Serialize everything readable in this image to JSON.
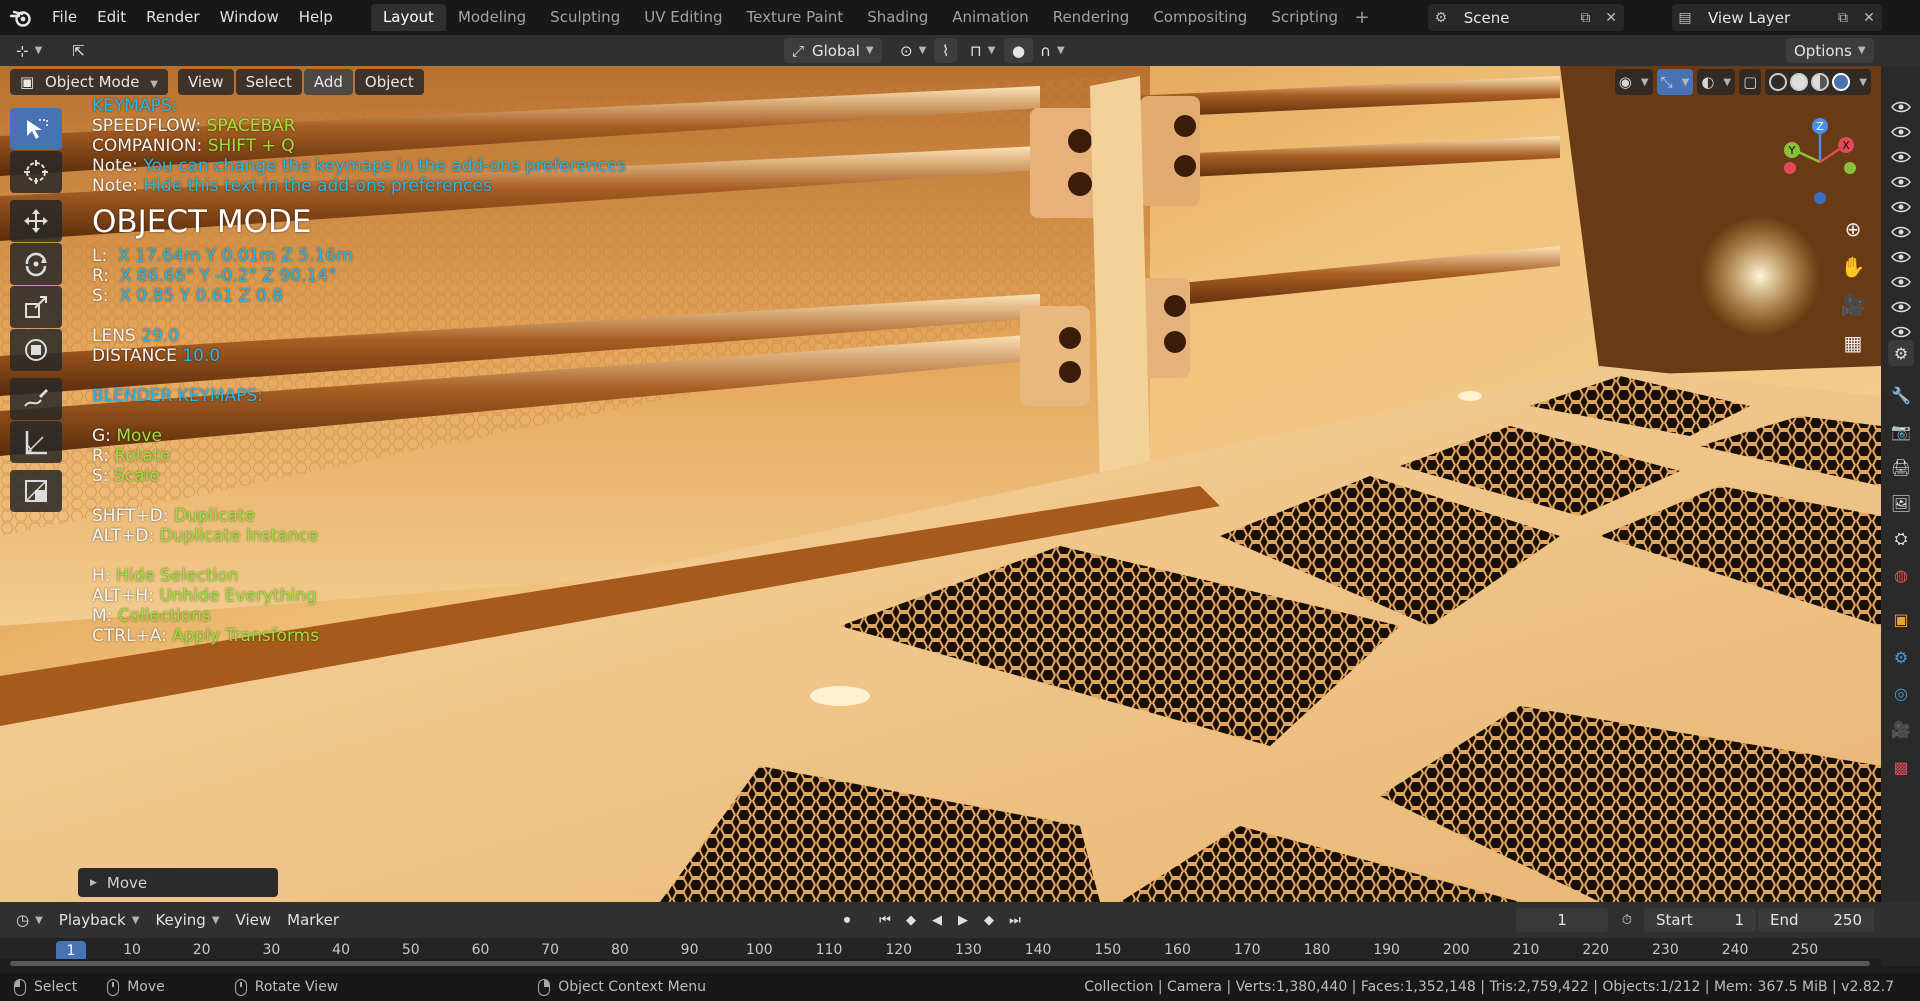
{
  "menubar": {
    "items": [
      "File",
      "Edit",
      "Render",
      "Window",
      "Help"
    ],
    "workspaces": [
      "Layout",
      "Modeling",
      "Sculpting",
      "UV Editing",
      "Texture Paint",
      "Shading",
      "Animation",
      "Rendering",
      "Compositing",
      "Scripting"
    ],
    "active_workspace": "Layout",
    "add_tab": "+",
    "scene": "Scene",
    "view_layer": "View Layer"
  },
  "header": {
    "orientation": "Global",
    "options": "Options"
  },
  "viewport_header": {
    "mode": "Object Mode",
    "menus": [
      "View",
      "Select",
      "Add",
      "Object"
    ]
  },
  "overlay": {
    "keymaps_title": "KEYMAPS:",
    "speedflow_label": "SPEEDFLOW:",
    "speedflow_key": "SPACEBAR",
    "companion_label": "COMPANION:",
    "companion_key": "SHIFT + Q",
    "note_label": "Note:",
    "note1": "You can change the keymaps in the add-ons preferences",
    "note2": "Hide this text in the add-ons preferences",
    "mode_title": "OBJECT MODE",
    "location_label": "L:",
    "location_value": "X 17.64m Y 0.01m Z 5.16m",
    "rotation_label": "R:",
    "rotation_value": "X 86.66° Y -0.2° Z 90.14°",
    "scale_label": "S:",
    "scale_value": "X 0.85 Y 0.61 Z 0.8",
    "lens_label": "LENS",
    "lens_value": "29.0",
    "distance_label": "DISTANCE",
    "distance_value": "10.0",
    "blender_keymaps_title": "BLENDER KEYMAPS:",
    "shortcuts": [
      {
        "key": "G:",
        "action": "Move"
      },
      {
        "key": "R:",
        "action": "Rotate"
      },
      {
        "key": "S:",
        "action": "Scale"
      },
      {
        "key": "SHFT+D:",
        "action": "Duplicate"
      },
      {
        "key": "ALT+D:",
        "action": "Duplicate Instance"
      },
      {
        "key": "H:",
        "action": "Hide Selection"
      },
      {
        "key": "ALT+H:",
        "action": "Unhide Everything"
      },
      {
        "key": "M:",
        "action": "Collections"
      },
      {
        "key": "CTRL+A:",
        "action": "Apply Transforms"
      }
    ]
  },
  "gizmo": {
    "x": "X",
    "y": "Y",
    "z": "Z"
  },
  "operator_panel": {
    "label": "Move"
  },
  "timeline": {
    "menus": [
      "Playback",
      "Keying",
      "View",
      "Marker"
    ],
    "current_frame": "1",
    "start_label": "Start",
    "start_value": "1",
    "end_label": "End",
    "end_value": "250",
    "ruler_current": "1",
    "ruler_ticks": [
      "10",
      "20",
      "30",
      "40",
      "50",
      "60",
      "70",
      "80",
      "90",
      "100",
      "110",
      "120",
      "130",
      "140",
      "150",
      "160",
      "170",
      "180",
      "190",
      "200",
      "210",
      "220",
      "230",
      "240",
      "250"
    ]
  },
  "statusbar": {
    "select": "Select",
    "move": "Move",
    "rotate_view": "Rotate View",
    "context_menu": "Object Context Menu",
    "stats": "Collection | Camera | Verts:1,380,440 | Faces:1,352,148 | Tris:2,759,422 | Objects:1/212 | Mem: 367.5 MiB | v2.82.7"
  },
  "colors": {
    "accent": "#4772b3",
    "overlay_cyan": "#29b6e8",
    "overlay_green": "#9be23b",
    "scene_base": "#e8a040"
  }
}
